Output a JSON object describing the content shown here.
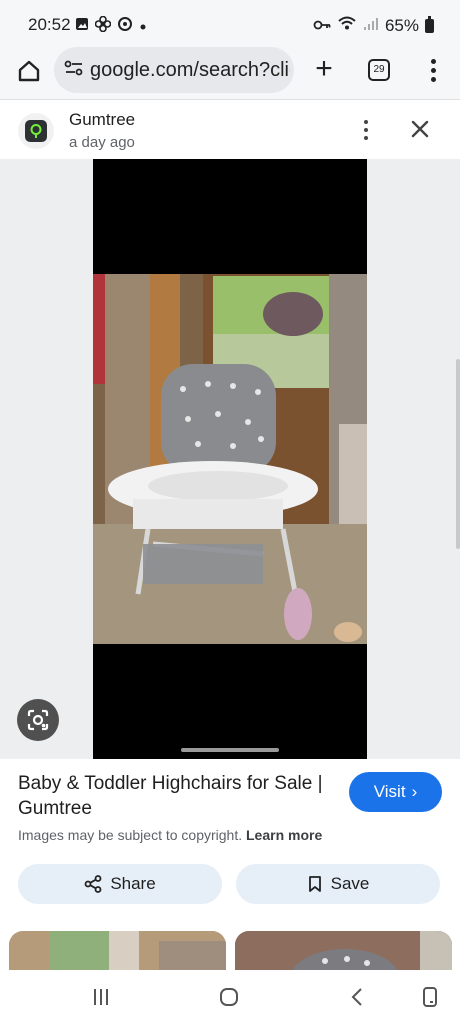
{
  "status": {
    "time": "20:52",
    "battery": "65%",
    "left_icons": [
      "gallery-icon",
      "fan-icon",
      "sync-icon",
      "notification-dot-icon"
    ],
    "right_icons": [
      "key-icon",
      "wifi-icon",
      "signal-icon",
      "battery-icon"
    ]
  },
  "browser": {
    "url": "google.com/search?clie",
    "tab_count": "29",
    "new_tab_label": "+"
  },
  "source": {
    "site_name": "Gumtree",
    "posted": "a day ago"
  },
  "result": {
    "title": "Baby & Toddler Highchairs for Sale | Gumtree",
    "visit_label": "Visit",
    "visit_chevron": "›",
    "copyright_text": "Images may be subject to copyright.",
    "learn_more": "Learn more",
    "share_label": "Share",
    "save_label": "Save"
  },
  "colors": {
    "accent": "#1a73e8",
    "action_button_bg": "#e6eef8",
    "viewer_bg": "#eceef0"
  },
  "nav": {
    "icons": [
      "recent-apps-icon",
      "home-nav-icon",
      "back-icon",
      "screenshot-icon"
    ]
  }
}
